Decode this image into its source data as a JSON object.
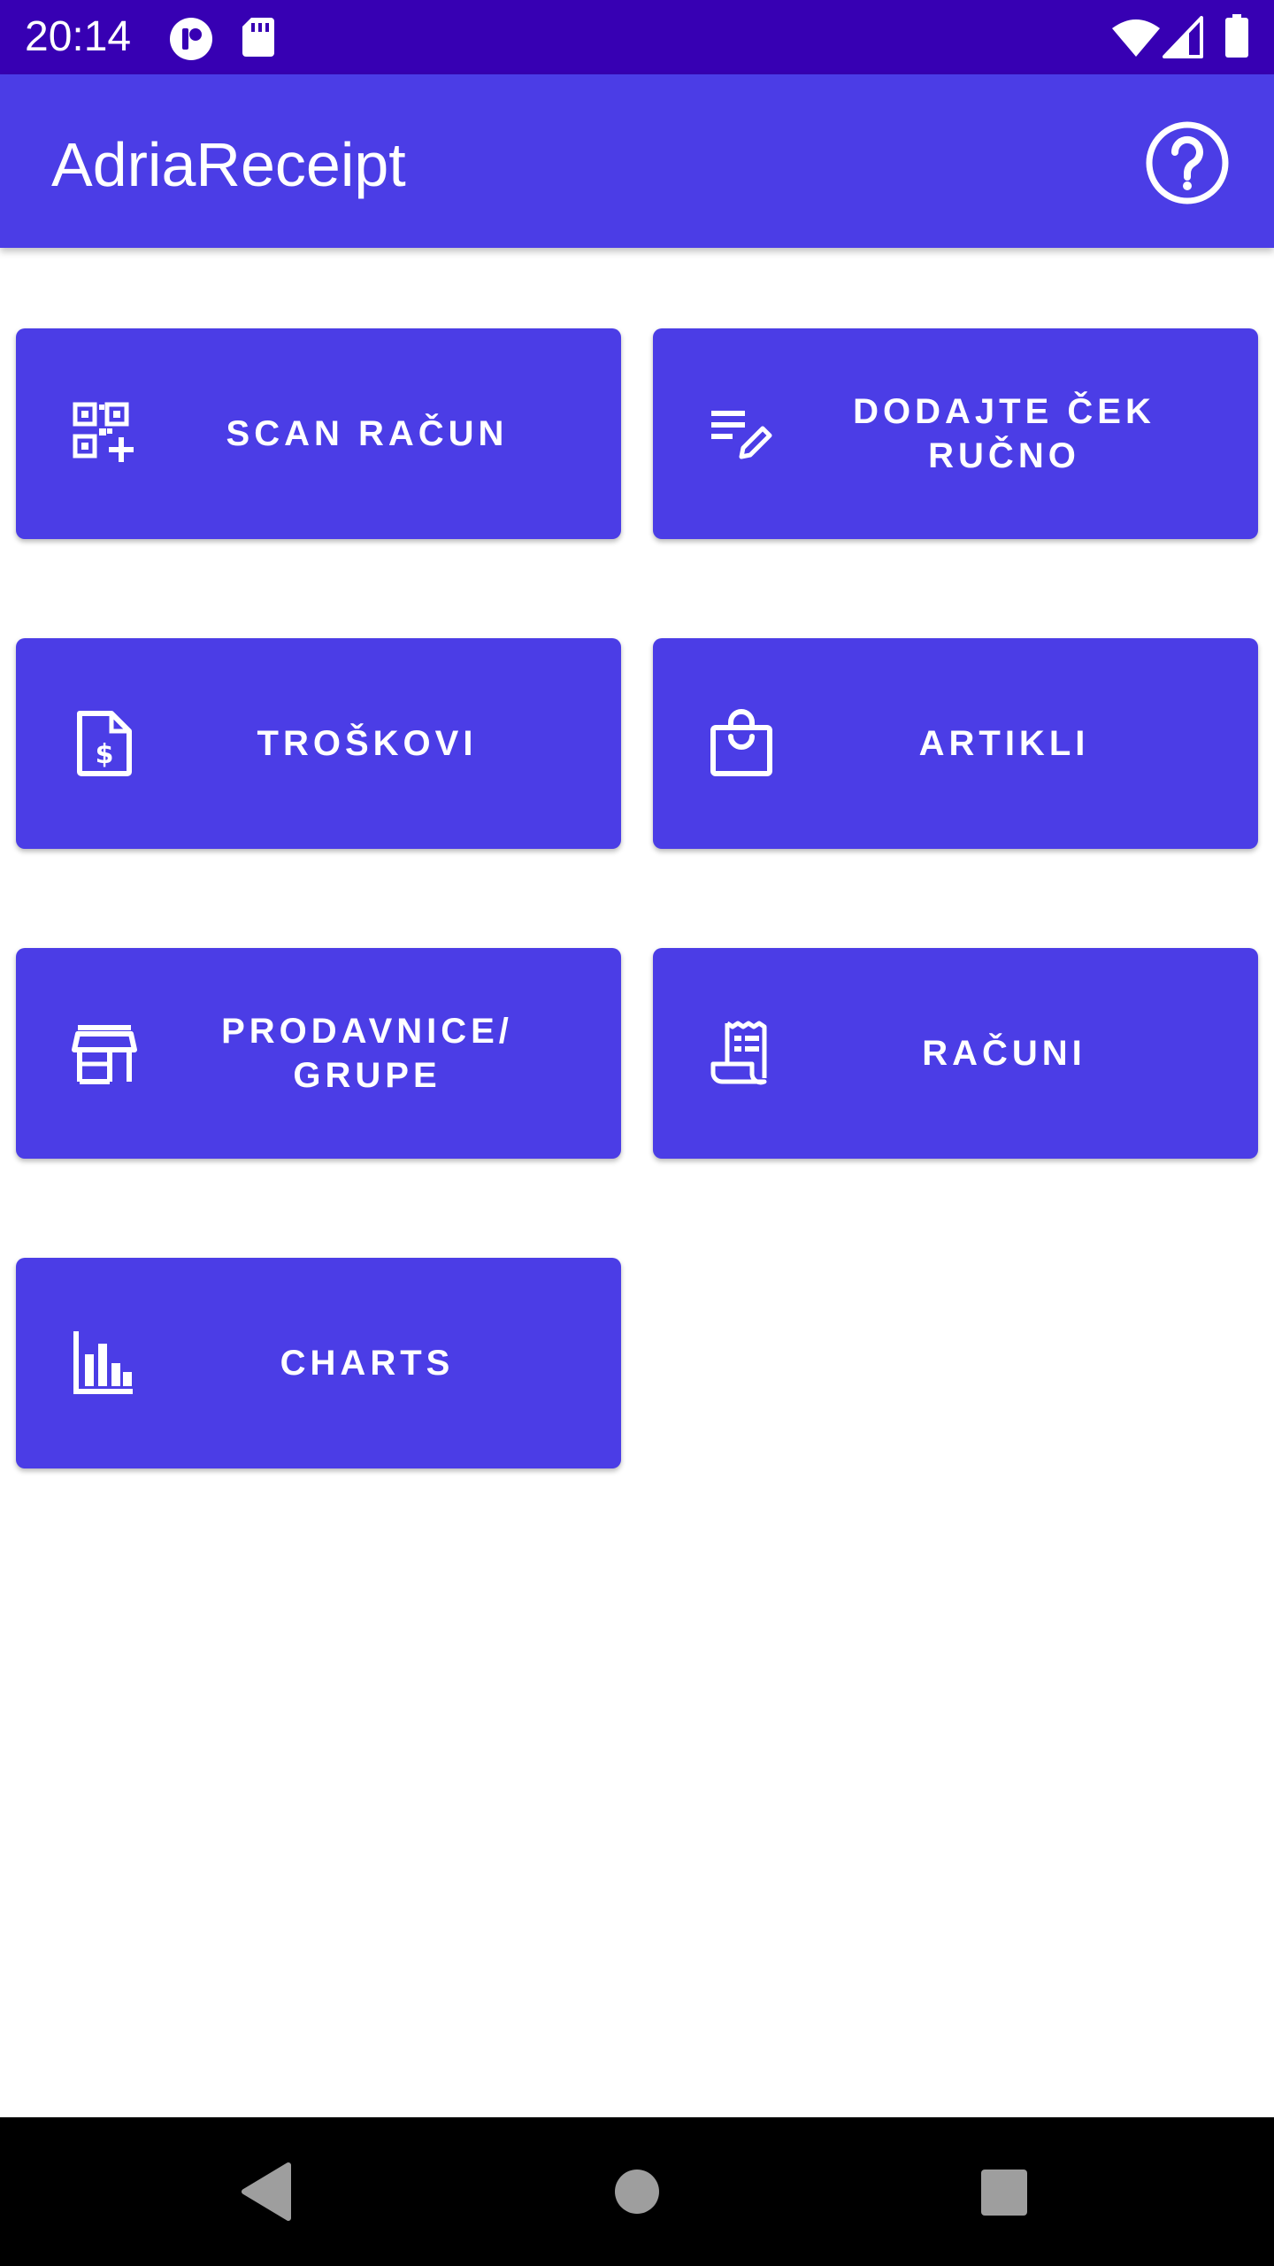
{
  "status_bar": {
    "time": "20:14",
    "icons": [
      "notification-icon",
      "sd-card-icon",
      "wifi-icon",
      "signal-icon",
      "battery-icon"
    ]
  },
  "app_bar": {
    "title": "AdriaReceipt",
    "help_icon": "help-circle-icon"
  },
  "tiles": [
    {
      "label": "SCAN RAČUN",
      "icon": "qr-code-add-icon"
    },
    {
      "label": "DODAJTE ČEK RUČNO",
      "icon": "edit-list-icon"
    },
    {
      "label": "TROŠKOVI",
      "icon": "dollar-document-icon"
    },
    {
      "label": "ARTIKLI",
      "icon": "shopping-bag-icon"
    },
    {
      "label": "PRODAVNICE/ GRUPE",
      "icon": "store-icon"
    },
    {
      "label": "RAČUNI",
      "icon": "receipt-icon"
    },
    {
      "label": "CHARTS",
      "icon": "bar-chart-icon"
    }
  ],
  "nav_bar": {
    "back": "back-icon",
    "home": "home-icon",
    "recents": "recents-icon"
  },
  "colors": {
    "status_bar": "#3700b3",
    "primary": "#4b3de6",
    "nav_bar": "#000000",
    "nav_icons": "#9e9e9e",
    "on_primary": "#ffffff"
  }
}
